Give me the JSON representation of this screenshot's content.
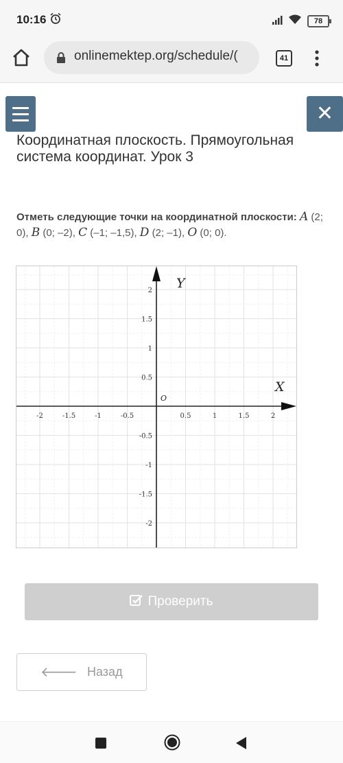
{
  "status_bar": {
    "time": "10:16",
    "battery": "78"
  },
  "browser": {
    "url": "onlinemektep.org/schedule/(",
    "tab_count": "41"
  },
  "page": {
    "title": "Координатная плоскость. Прямоугольная система координат. Урок 3",
    "question_bold": "Отметь следующие точки на координатной плоскости:",
    "points": [
      {
        "name": "A",
        "coords": "(2; 0),"
      },
      {
        "name": "B",
        "coords": "(0; –2),"
      },
      {
        "name": "C",
        "coords": "(–1; –1,5),"
      },
      {
        "name": "D",
        "coords": "(2; –1),"
      },
      {
        "name": "O",
        "coords": "(0; 0)."
      }
    ],
    "check_label": "Проверить",
    "back_label": "Назад"
  },
  "graph": {
    "x_axis_label": "X",
    "y_axis_label": "Y",
    "origin_label": "O",
    "x_ticks": [
      "-2",
      "-1.5",
      "-1",
      "-0.5",
      "0.5",
      "1",
      "1.5",
      "2"
    ],
    "y_ticks": [
      "2",
      "1.5",
      "1",
      "0.5",
      "-0.5",
      "-1",
      "-1.5",
      "-2"
    ],
    "x_values": [
      -2,
      -1.5,
      -1,
      -0.5,
      0.5,
      1,
      1.5,
      2
    ],
    "y_values": [
      2,
      1.5,
      1,
      0.5,
      -0.5,
      -1,
      -1.5,
      -2
    ],
    "grid": true
  },
  "icons": {
    "alarm": "alarm-clock-icon",
    "signal": "signal-icon",
    "wifi": "wifi-icon",
    "home": "home-icon",
    "lock": "lock-icon",
    "menu": "hamburger-icon",
    "close": "close-icon",
    "check": "checkbox-icon",
    "back": "arrow-left-icon"
  },
  "colors": {
    "accent": "#4f6f89",
    "button_disabled": "#cfcfcf"
  }
}
